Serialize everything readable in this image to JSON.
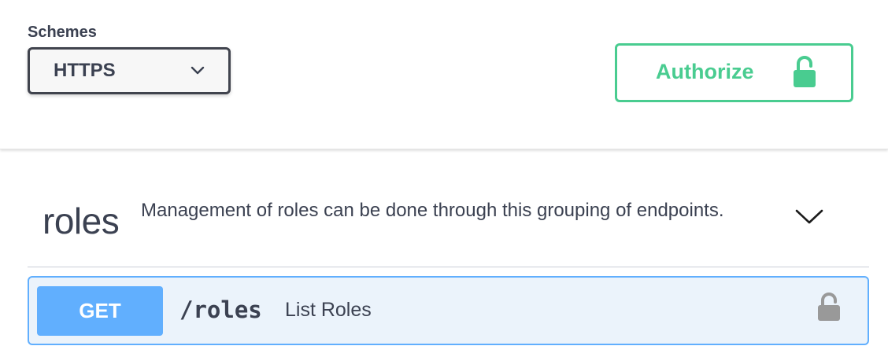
{
  "schemes": {
    "label": "Schemes",
    "selected": "HTTPS"
  },
  "authorize": {
    "label": "Authorize",
    "color": "#49cc90"
  },
  "tag": {
    "name": "roles",
    "description": "Management of roles can be done through this grouping of endpoints."
  },
  "operation": {
    "method": "GET",
    "path": "/roles",
    "summary": "List Roles",
    "method_color": "#61affe"
  },
  "icons": {
    "scheme_dropdown": "chevron-down-icon",
    "authorize_lock": "lock-icon",
    "tag_toggle": "chevron-down-icon",
    "operation_lock": "lock-icon"
  }
}
